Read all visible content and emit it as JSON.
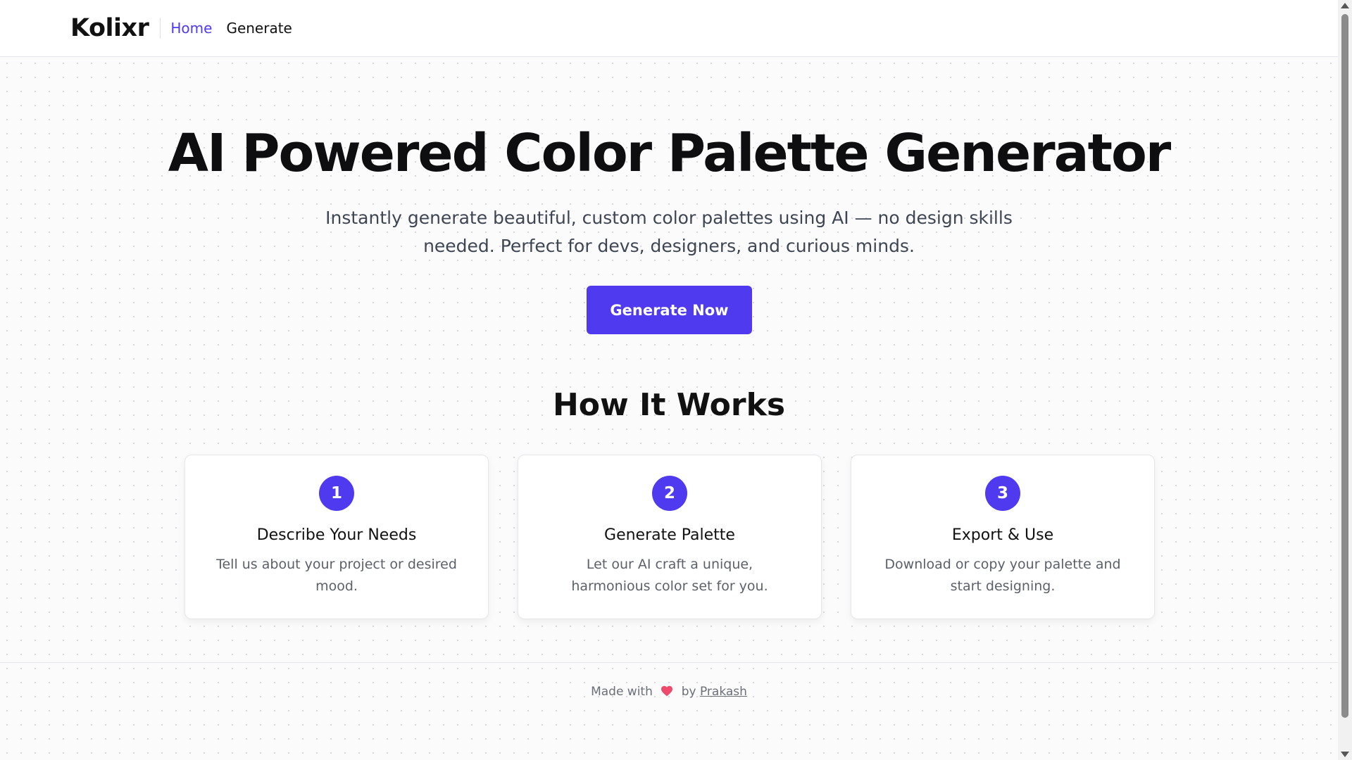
{
  "nav": {
    "brand": "Kolixr",
    "links": [
      {
        "label": "Home",
        "active": true
      },
      {
        "label": "Generate",
        "active": false
      }
    ]
  },
  "hero": {
    "title": "AI Powered Color Palette Generator",
    "subtitle_line1": "Instantly generate beautiful, custom color palettes using AI — no design skills",
    "subtitle_line2": "needed. Perfect for devs, designers, and curious minds.",
    "cta_label": "Generate Now"
  },
  "how_it_works": {
    "title": "How It Works",
    "steps": [
      {
        "number": "1",
        "title": "Describe Your Needs",
        "description": "Tell us about your project or desired mood."
      },
      {
        "number": "2",
        "title": "Generate Palette",
        "description": "Let our AI craft a unique, harmonious color set for you."
      },
      {
        "number": "3",
        "title": "Export & Use",
        "description": "Download or copy your palette and start designing."
      }
    ]
  },
  "footer": {
    "made_with": "Made with",
    "heart_icon": "heart-icon",
    "by": "by",
    "author": "Prakash"
  },
  "colors": {
    "accent": "#4f3af0",
    "heart": "#ef4a6b"
  }
}
